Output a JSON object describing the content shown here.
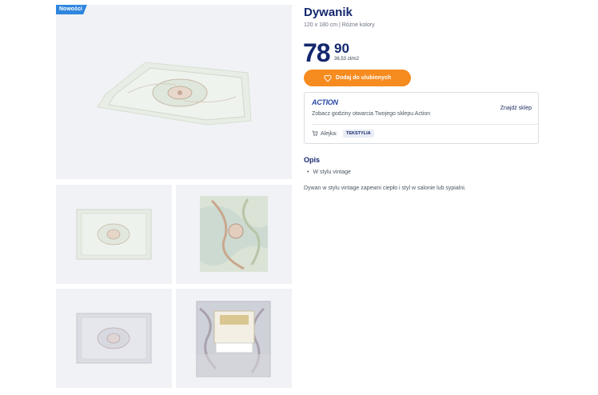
{
  "badge": "Nowości",
  "product": {
    "title": "Dywanik",
    "subtitle": "120 x 180 cm | Różne kolory",
    "price_int": "78",
    "price_dec": "90",
    "unit_price": "36,53 zł/m2",
    "fav_label": "Dodaj do ulubionych"
  },
  "store": {
    "logo": "ACTION",
    "hours_text": "Zobacz godziny otwarcia Twojego sklepu Action",
    "find_label": "Znajdź sklep",
    "aisle_label": "Alejka:",
    "aisle_value": "TEKSTYLIA"
  },
  "description": {
    "heading": "Opis",
    "bullets": [
      "W stylu vintage"
    ],
    "text": "Dywan w stylu vintage zapewni ciepło i styl w salonie lub sypialni."
  },
  "colors": {
    "accent": "#f68b1f",
    "brand": "#14286e",
    "badge": "#2e86de"
  }
}
